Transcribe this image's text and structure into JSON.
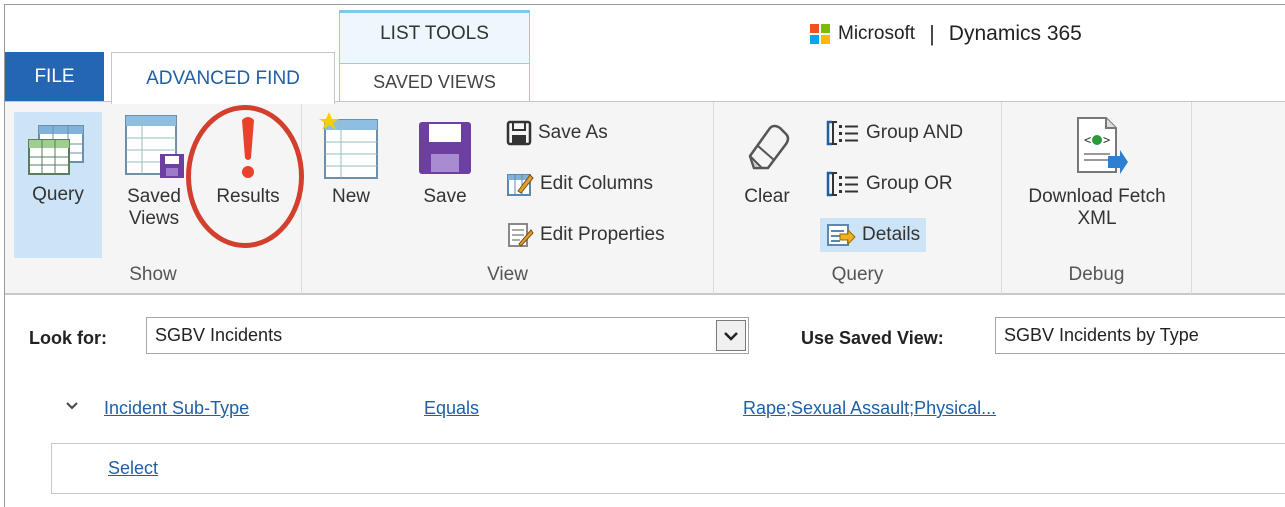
{
  "tabs": {
    "file": "FILE",
    "advanced_find": "ADVANCED FIND",
    "context_group": "LIST TOOLS",
    "saved_views": "SAVED VIEWS"
  },
  "brand": {
    "company": "Microsoft",
    "separator": "|",
    "product": "Dynamics 365",
    "logo_colors": [
      "#f25022",
      "#7fba00",
      "#00a4ef",
      "#ffb900"
    ]
  },
  "ribbon": {
    "show": {
      "label": "Show",
      "query": {
        "label": "Query",
        "icon": "query-table-icon",
        "selected": true
      },
      "saved_views": {
        "label_line1": "Saved",
        "label_line2": "Views",
        "icon": "saved-views-icon"
      },
      "results": {
        "label": "Results",
        "icon": "exclamation-icon"
      }
    },
    "view": {
      "label": "View",
      "new": {
        "label": "New",
        "icon": "new-view-icon"
      },
      "save": {
        "label": "Save",
        "icon": "save-floppy-icon"
      },
      "save_as": {
        "label": "Save As",
        "icon": "save-as-icon"
      },
      "edit_columns": {
        "label": "Edit Columns",
        "icon": "edit-columns-icon"
      },
      "edit_properties": {
        "label": "Edit Properties",
        "icon": "edit-properties-icon"
      }
    },
    "query": {
      "label": "Query",
      "clear": {
        "label": "Clear",
        "icon": "eraser-icon"
      },
      "group_and": {
        "label": "Group AND",
        "icon": "group-bracket-icon"
      },
      "group_or": {
        "label": "Group OR",
        "icon": "group-bracket-icon"
      },
      "details": {
        "label": "Details",
        "icon": "details-icon",
        "selected": true
      }
    },
    "debug": {
      "label": "Debug",
      "download_fetch": {
        "label_line1": "Download Fetch",
        "label_line2": "XML",
        "icon": "xml-download-icon"
      }
    }
  },
  "search": {
    "look_for_label": "Look for:",
    "look_for_value": "SGBV Incidents",
    "use_saved_view_label": "Use Saved View:",
    "use_saved_view_value": "SGBV Incidents by Type"
  },
  "condition": {
    "field": "Incident Sub-Type",
    "operator": "Equals",
    "value": "Rape;Sexual Assault;Physical..."
  },
  "select_link": "Select",
  "colors": {
    "file_tab": "#2566b3",
    "link": "#1f5fa5",
    "highlight_circle": "#d2402d",
    "selected": "#cde4f6"
  }
}
